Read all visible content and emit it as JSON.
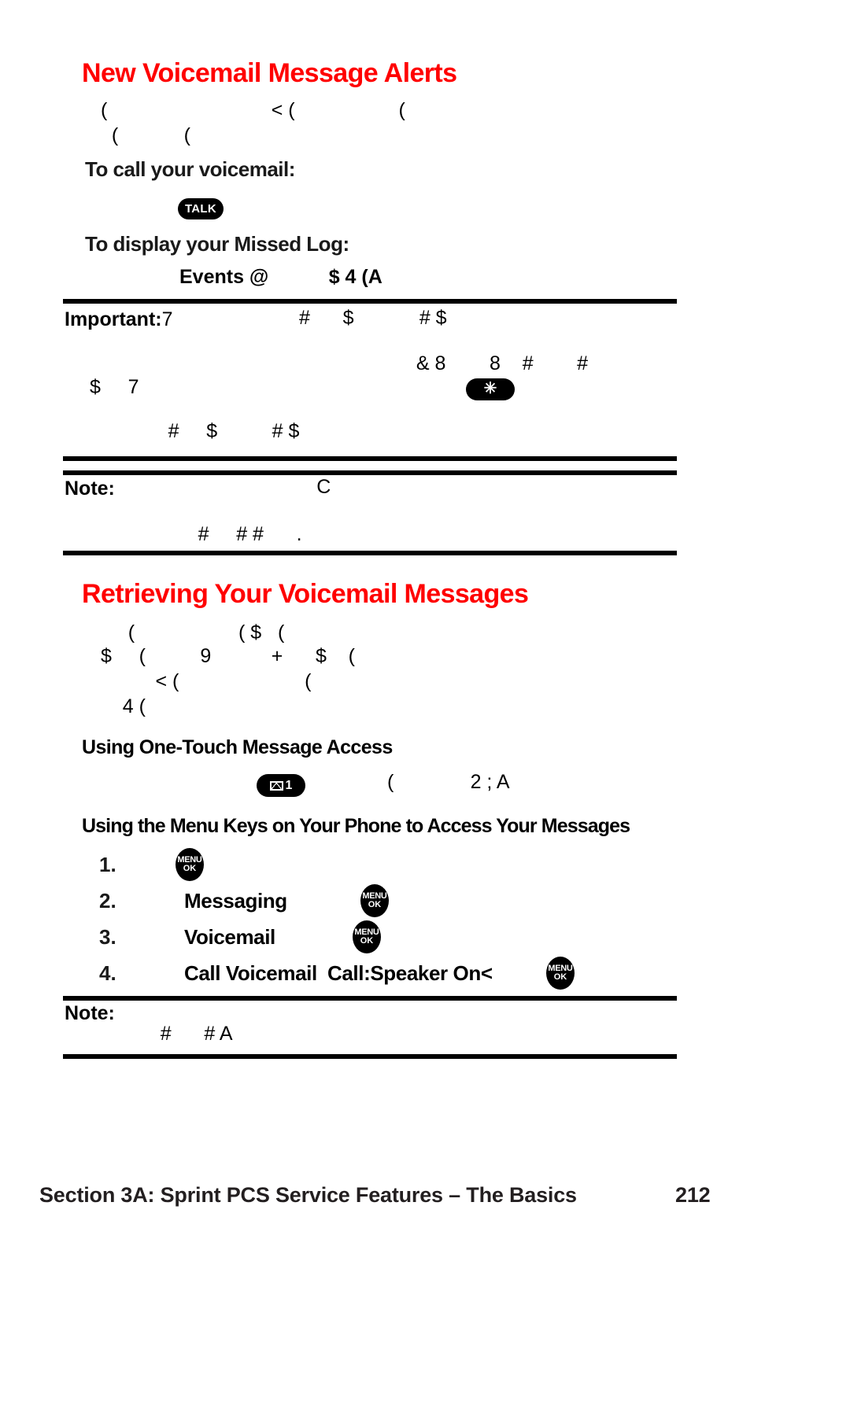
{
  "page": {
    "number": "212",
    "footer_section": "Section 3A: Sprint PCS Service Features – The Basics",
    "accent_color": "#ff0000"
  },
  "sections": [
    {
      "title": "New Voicemail Message Alerts",
      "intro_lines": [
        "(                              < (                   (",
        "  (            ("
      ],
      "sub1": {
        "heading": "To call your voicemail:",
        "key_label": "TALK"
      },
      "sub2": {
        "heading": "To display your Missed Log:",
        "line": "Events @           $ 4 (A"
      }
    },
    {
      "title": "Retrieving Your Voicemail Messages",
      "intro_lines": [
        "     (                   ( $   (",
        "$     (          9           +      $    (",
        "          < (                       (",
        "    4 ("
      ],
      "sub1": {
        "heading": "Using One-Touch Message Access",
        "key_label": "1",
        "key_icon": "envelope-icon",
        "line_after": "(              2 ; A"
      },
      "sub2": {
        "heading": "Using the Menu Keys on Your Phone to Access Your Messages",
        "steps": [
          {
            "num": "1.",
            "bold_a": "",
            "bold_b": "",
            "key": "MENU OK"
          },
          {
            "num": "2.",
            "bold_a": "Messaging",
            "bold_b": "",
            "key": "MENU OK"
          },
          {
            "num": "3.",
            "bold_a": "Voicemail",
            "bold_b": "",
            "key": "MENU OK"
          },
          {
            "num": "4.",
            "bold_a": "Call Voicemail",
            "bold_b": "Call:Speaker On<",
            "key": "MENU OK"
          }
        ]
      }
    }
  ],
  "callouts": [
    {
      "label": "Important:",
      "lead": "7",
      "lines": [
        "#      $            # $",
        "",
        "                    & 8        8    #        #",
        "$     7",
        "      #     $          # $"
      ]
    },
    {
      "label": "Note:",
      "lines": [
        "                                C",
        "",
        "        #     # #      ."
      ]
    },
    {
      "label": "Note:",
      "lines": [
        "    #      # A"
      ]
    }
  ],
  "keys": {
    "talk": "TALK",
    "star": "✳",
    "menu_line1": "MENU",
    "menu_line2": "OK",
    "msg_num": "1"
  }
}
